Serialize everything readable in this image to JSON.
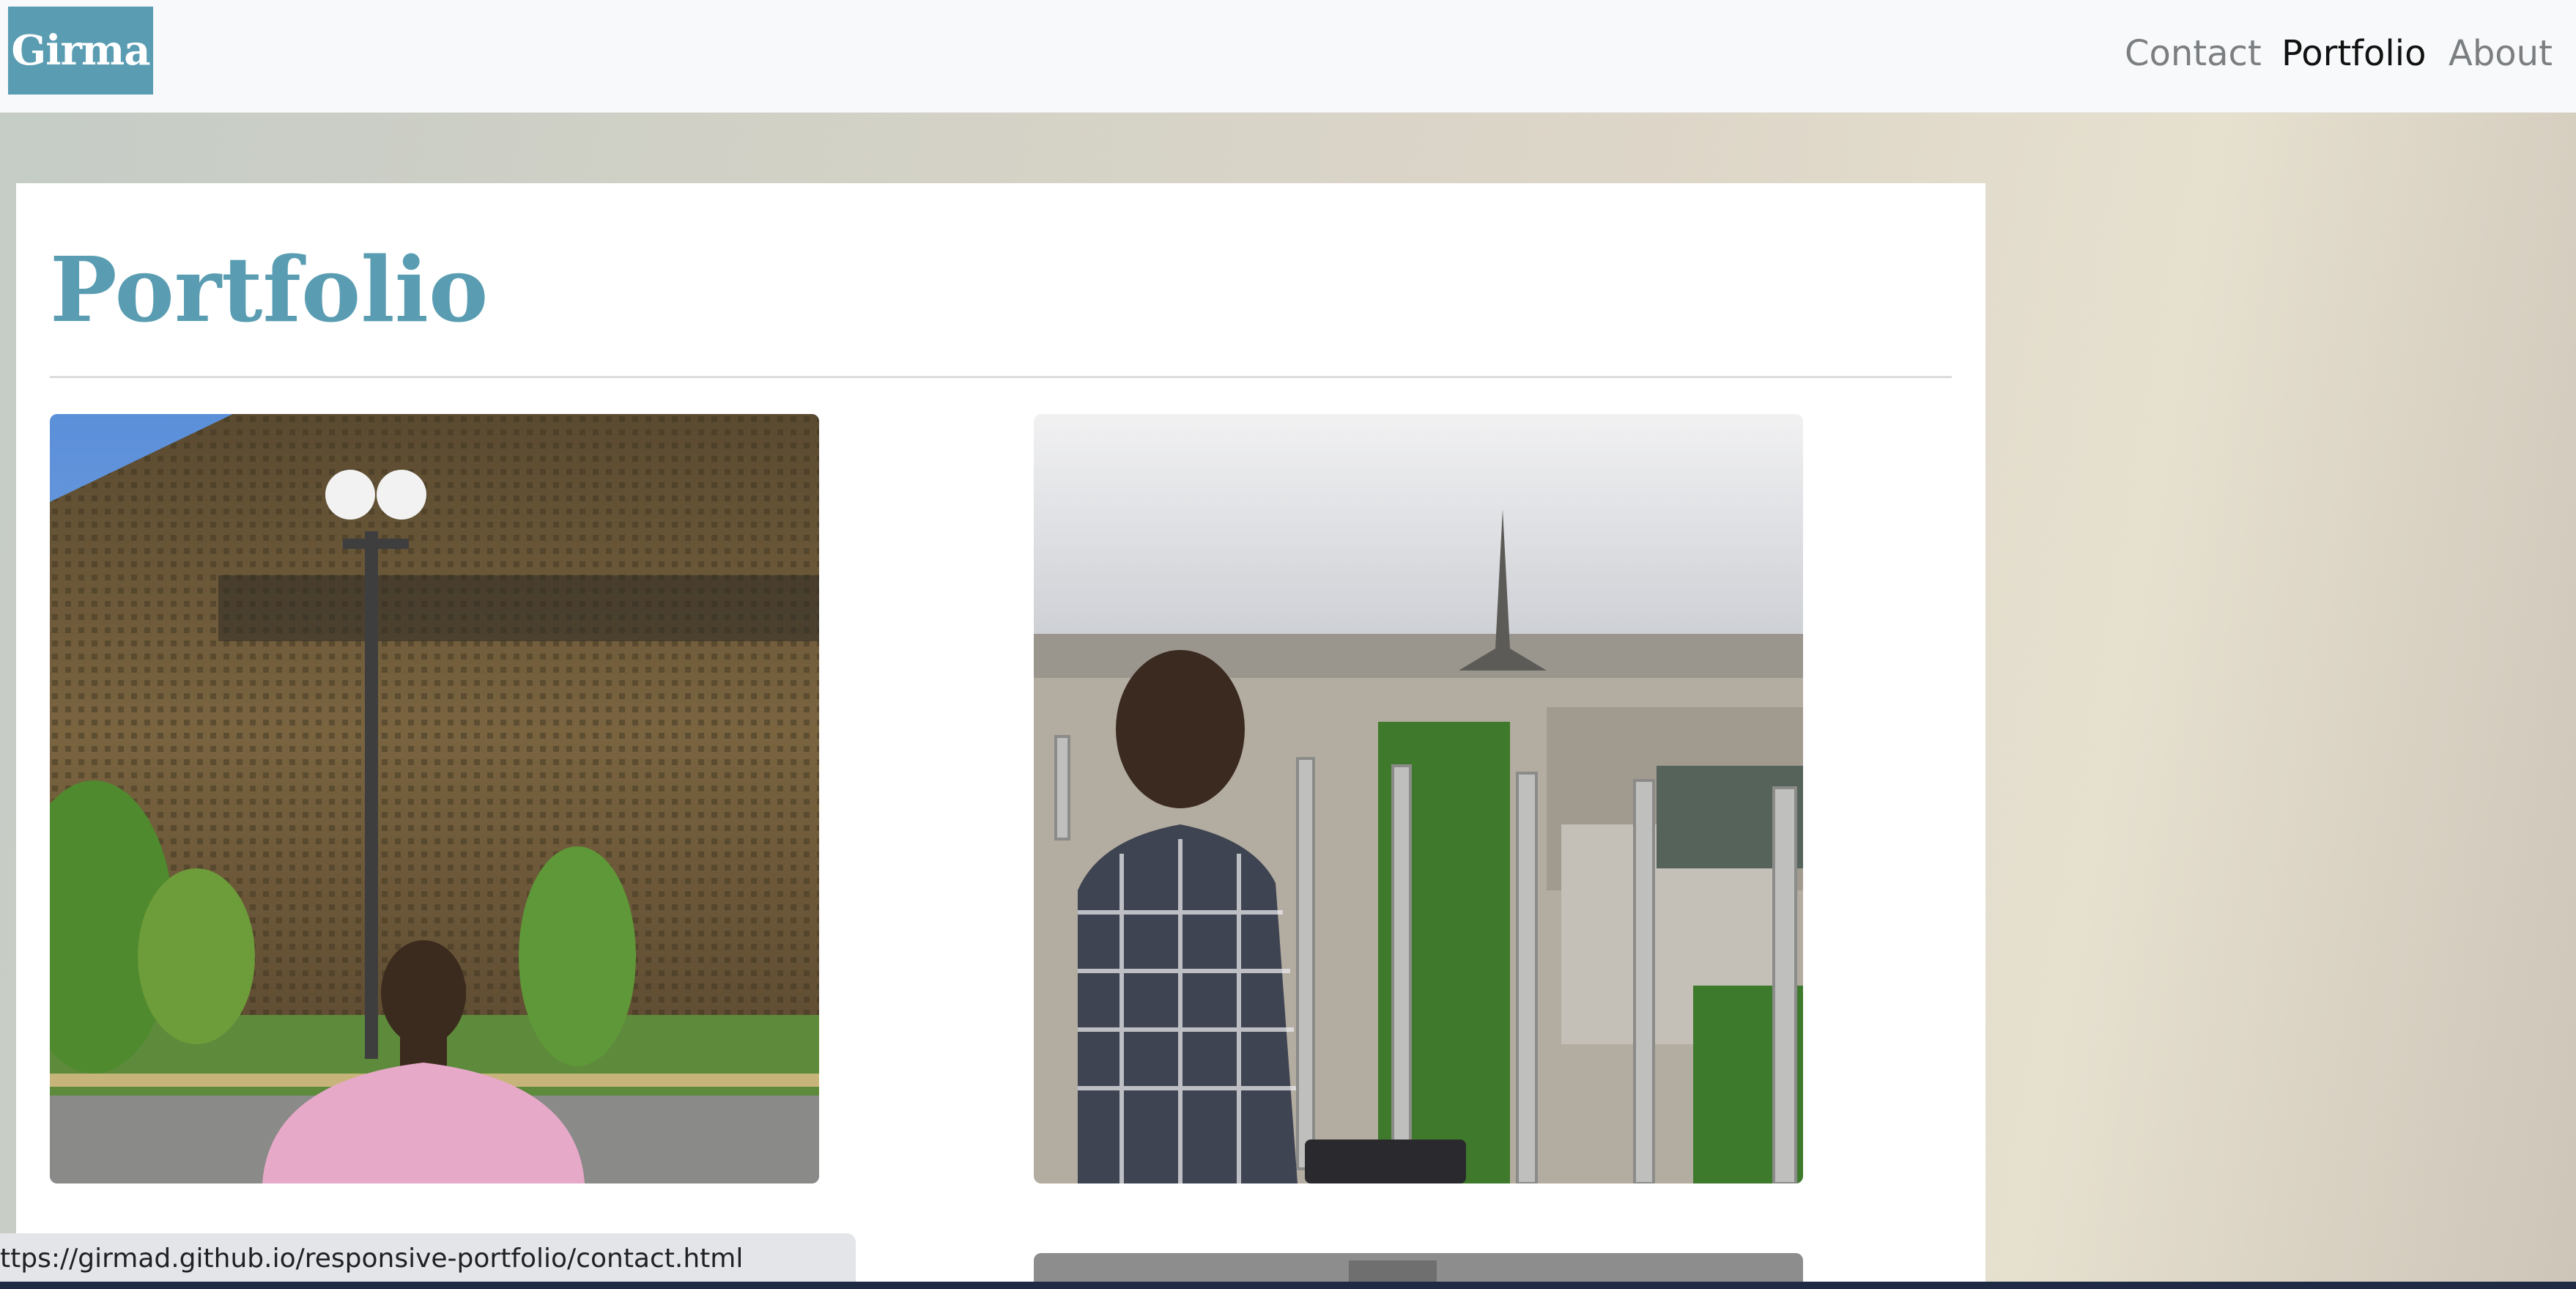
{
  "navbar": {
    "brand": "Girma",
    "links": [
      {
        "label": "Contact",
        "active": false
      },
      {
        "label": "Portfolio",
        "active": true
      },
      {
        "label": "About",
        "active": false
      }
    ]
  },
  "main": {
    "title": "Portfolio",
    "photos": [
      {
        "icon": "photo-museum-portrait"
      },
      {
        "icon": "photo-paris-eiffel-portrait"
      },
      {
        "icon": "photo-partial"
      }
    ]
  },
  "status_bar": {
    "link_preview": "ttps://girmad.github.io/responsive-portfolio/contact.html"
  },
  "colors": {
    "brand": "#5a9db2",
    "navbar_bg": "#f8f9fa",
    "nav_link": "#7b7f82",
    "nav_link_active": "#111111"
  }
}
